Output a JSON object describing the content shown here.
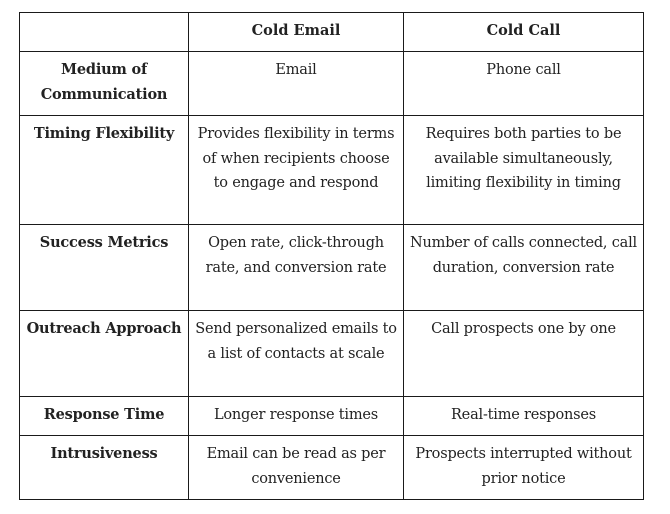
{
  "table": {
    "headers": [
      "",
      "Cold Email",
      "Cold Call"
    ],
    "rows": [
      {
        "label": "Medium of Communication",
        "cold_email": "Email",
        "cold_call": "Phone call"
      },
      {
        "label": "Timing Flexibility",
        "cold_email": "Provides flexibility in terms of when recipients choose to engage and respond",
        "cold_call": "Requires both parties to be available simultaneously, limiting flexibility in timing"
      },
      {
        "label": "Success Metrics",
        "cold_email": "Open rate, click-through rate, and conversion rate",
        "cold_call": "Number of calls connected, call duration, conversion rate"
      },
      {
        "label": "Outreach Approach",
        "cold_email": "Send personalized emails to a list of contacts at scale",
        "cold_call": "Call prospects one by one"
      },
      {
        "label": "Response Time",
        "cold_email": "Longer response times",
        "cold_call": "Real-time responses"
      },
      {
        "label": "Intrusiveness",
        "cold_email": "Email can be read as per convenience",
        "cold_call": "Prospects interrupted without prior notice"
      }
    ]
  }
}
